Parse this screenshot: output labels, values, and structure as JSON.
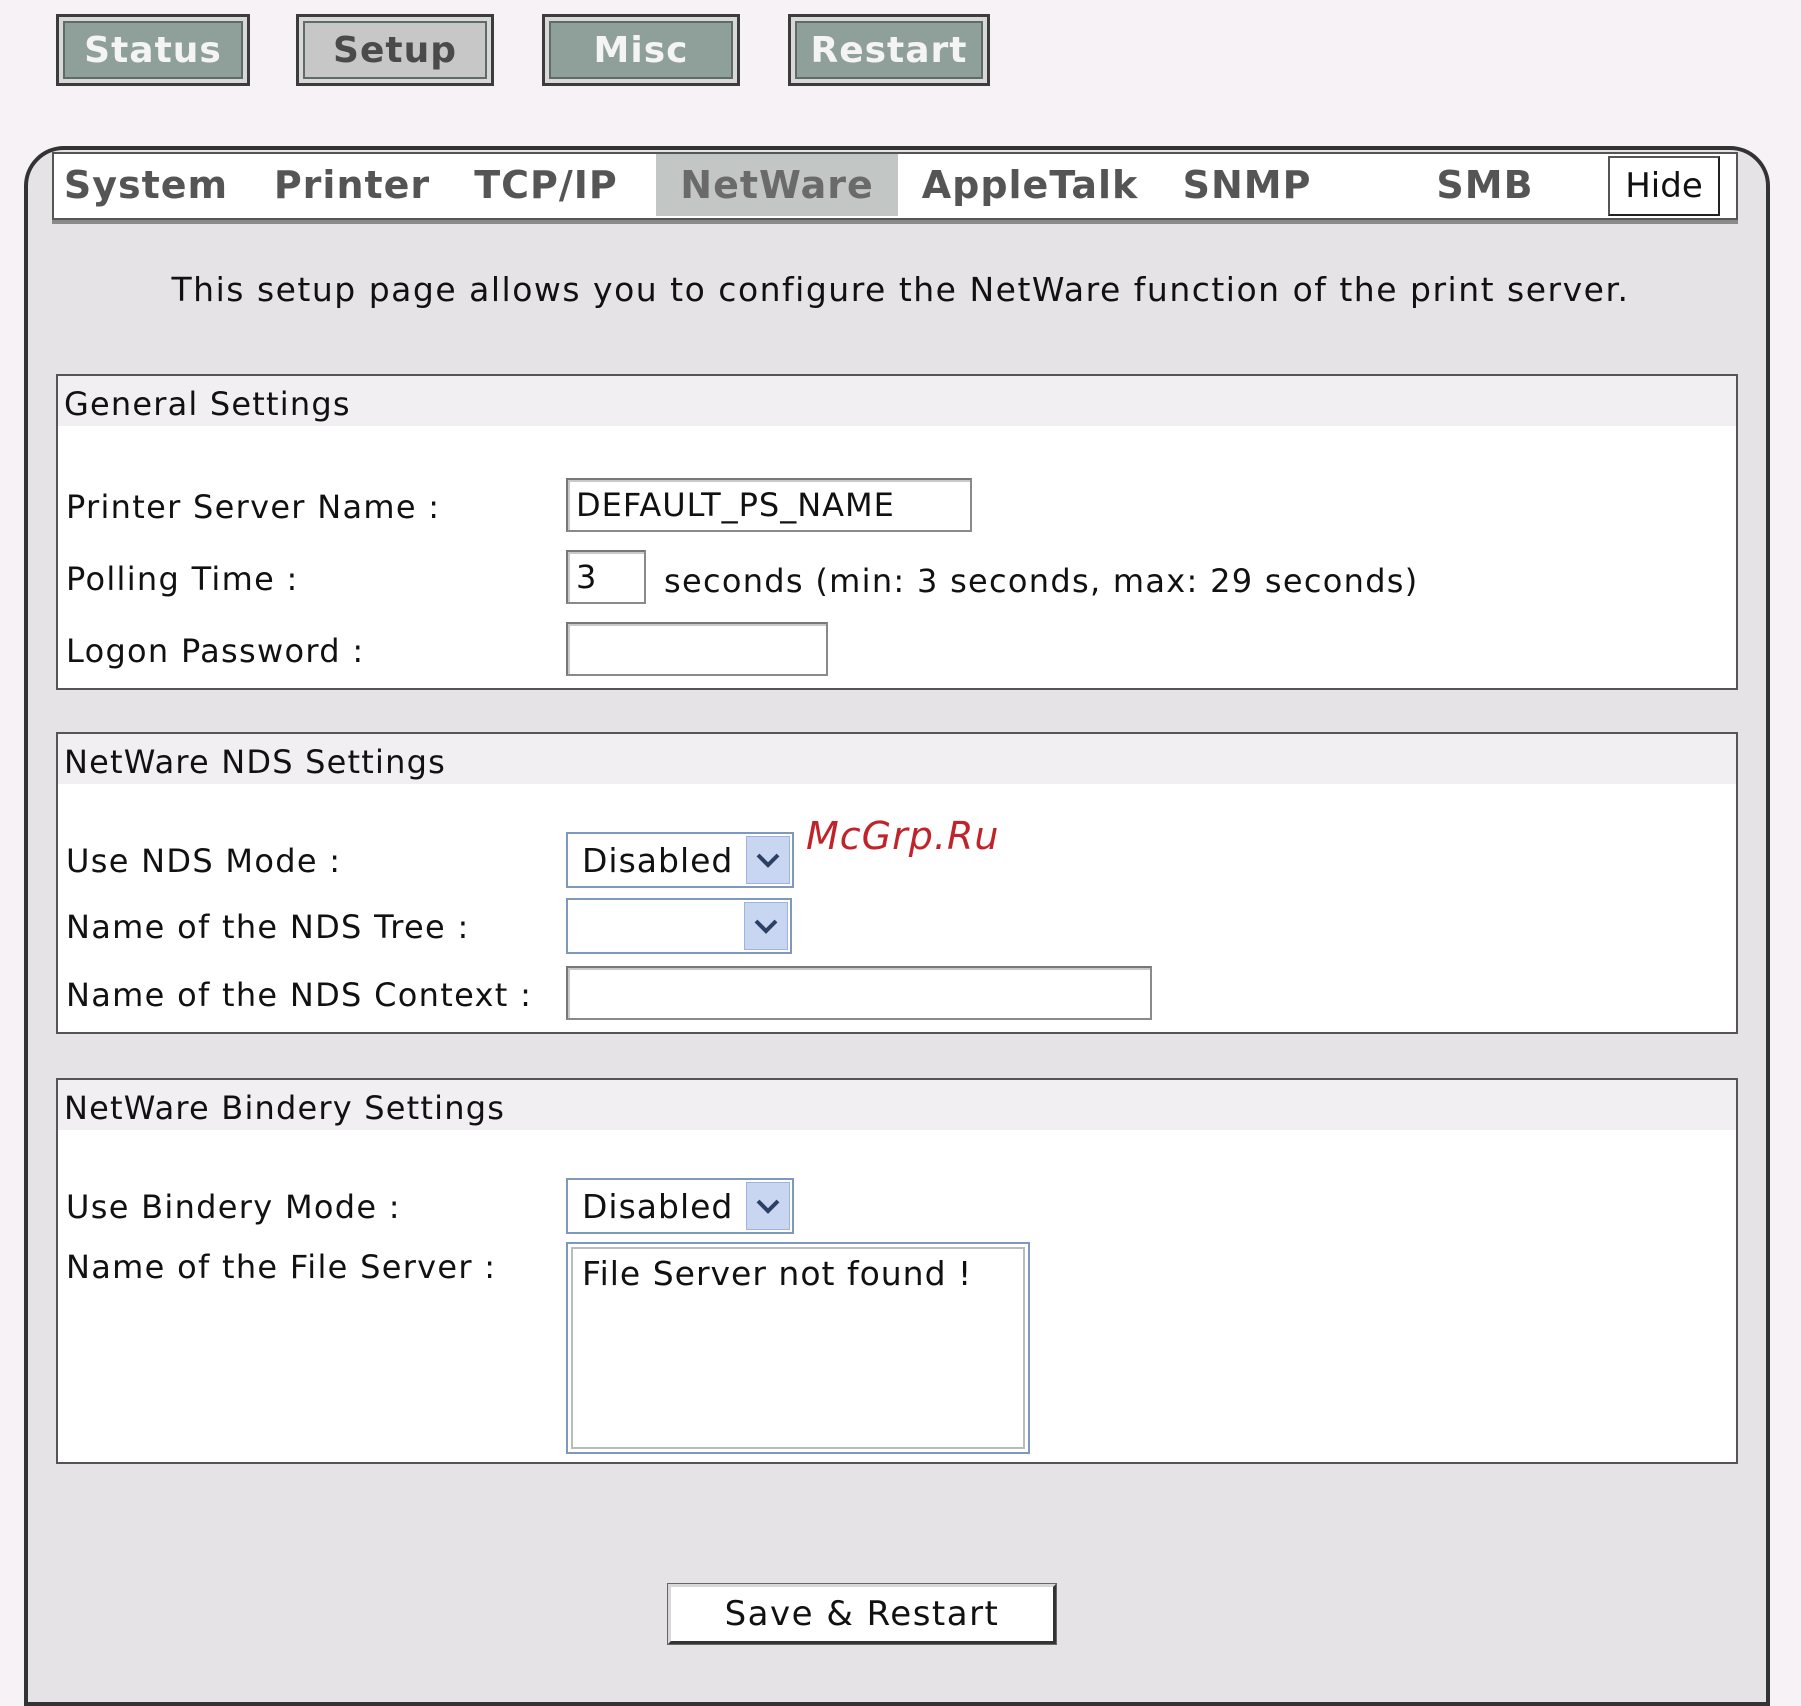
{
  "top_nav": [
    {
      "label": "Status",
      "active": false
    },
    {
      "label": "Setup",
      "active": true
    },
    {
      "label": "Misc",
      "active": false
    },
    {
      "label": "Restart",
      "active": false
    }
  ],
  "tabs": [
    {
      "label": "System",
      "active": false
    },
    {
      "label": "Printer",
      "active": false
    },
    {
      "label": "TCP/IP",
      "active": false
    },
    {
      "label": "NetWare",
      "active": true
    },
    {
      "label": "AppleTalk",
      "active": false
    },
    {
      "label": "SNMP",
      "active": false
    },
    {
      "label": "SMB",
      "active": false
    }
  ],
  "hide_label": "Hide",
  "intro": "This setup page allows you to configure the NetWare function of the print server.",
  "general": {
    "legend": "General Settings",
    "ps_name_label": "Printer Server Name :",
    "ps_name_value": "DEFAULT_PS_NAME",
    "polling_label": "Polling Time :",
    "polling_value": "3",
    "polling_hint": "seconds (min: 3 seconds, max: 29 seconds)",
    "password_label": "Logon Password :",
    "password_value": ""
  },
  "nds": {
    "legend": "NetWare NDS Settings",
    "mode_label": "Use NDS Mode :",
    "mode_value": "Disabled",
    "tree_label": "Name of the NDS Tree :",
    "tree_value": "",
    "context_label": "Name of the NDS Context :",
    "context_value": ""
  },
  "bindery": {
    "legend": "NetWare Bindery Settings",
    "mode_label": "Use Bindery Mode :",
    "mode_value": "Disabled",
    "fileserver_label": "Name of the File Server :",
    "fileserver_value": "File Server not found !"
  },
  "save_label": "Save & Restart",
  "watermark": "McGrp.Ru",
  "colors": {
    "page_bg": "#f6f2f5",
    "panel_bg": "#e6e3e6",
    "top_button": "#8f9f9a",
    "active_tab": "#c2c6c4",
    "select_border": "#7d99bd",
    "watermark": "#c0242a"
  }
}
